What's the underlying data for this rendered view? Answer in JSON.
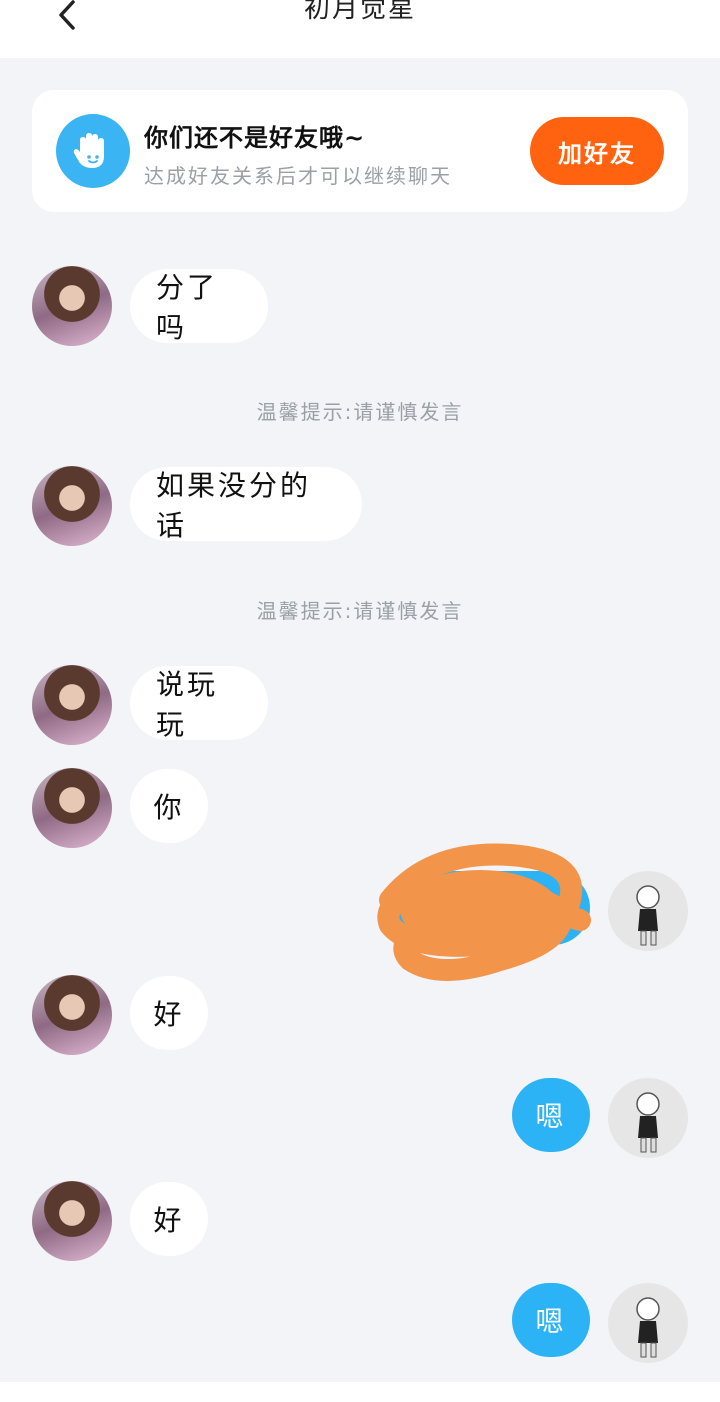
{
  "header": {
    "title": "初月觉星",
    "back_icon": "chevron-left-icon"
  },
  "friend_banner": {
    "icon": "wave-hand-icon",
    "title": "你们还不是好友哦~",
    "subtitle": "达成好友关系后才可以继续聊天",
    "add_button_label": "加好友",
    "accent_color": "#ff6310",
    "icon_color": "#3ab4f2"
  },
  "messages": [
    {
      "side": "left",
      "text": "分了吗"
    },
    {
      "type": "tip",
      "text": "温馨提示:请谨慎发言"
    },
    {
      "side": "left",
      "text": "如果没分的话"
    },
    {
      "type": "tip",
      "text": "温馨提示:请谨慎发言"
    },
    {
      "side": "left",
      "text": "说玩玩"
    },
    {
      "side": "left",
      "text": "你"
    },
    {
      "side": "right",
      "text": "",
      "redacted": true
    },
    {
      "side": "left",
      "text": "好"
    },
    {
      "side": "right",
      "text": "嗯"
    },
    {
      "side": "left",
      "text": "好"
    },
    {
      "side": "right",
      "text": "嗯"
    }
  ],
  "colors": {
    "background": "#f2f4f7",
    "sent_bubble": "#2cb3f5",
    "received_bubble": "#ffffff",
    "redaction": "#f2944a"
  }
}
